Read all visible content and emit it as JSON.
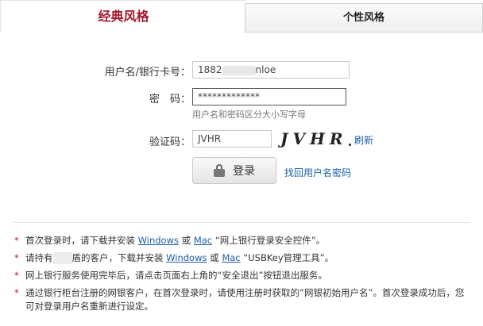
{
  "tabs": {
    "classic": "经典风格",
    "personal": "个性风格"
  },
  "form": {
    "username_label": "用户名/银行卡号：",
    "username_prefix": "1882",
    "username_suffix": "nloe",
    "password_label": "密　码：",
    "password_value": "*************",
    "hint": "用户名和密码区分大小写字母",
    "captcha_label": "验证码：",
    "captcha_value": "JVHR",
    "captcha_image_text": "JVHR",
    "refresh_link": "刷新",
    "login_button": "登录",
    "forgot_link": "找回用户名密码"
  },
  "notes": [
    {
      "parts": [
        "首次登录时，请下载并安装 ",
        "Windows",
        " 或 ",
        "Mac",
        " “网上银行登录安全控件”。"
      ]
    },
    {
      "parts": [
        "请持有",
        "",
        "盾的客户，下载并安装 ",
        "Windows",
        " 或 ",
        "Mac",
        " “USBKey管理工具”。"
      ]
    },
    {
      "text": "网上银行服务使用完毕后，请点击页面右上角的“安全退出”按钮退出服务。"
    },
    {
      "text": "通过银行柜台注册的网银客户，在首次登录时，请使用注册时获取的“网银初始用户名”。首次登录成功后，您可对登录用户名重新进行设定。"
    }
  ],
  "colors": {
    "brand_red": "#a3172b",
    "link_blue": "#1a5fa8",
    "note_star": "#c8102e"
  }
}
